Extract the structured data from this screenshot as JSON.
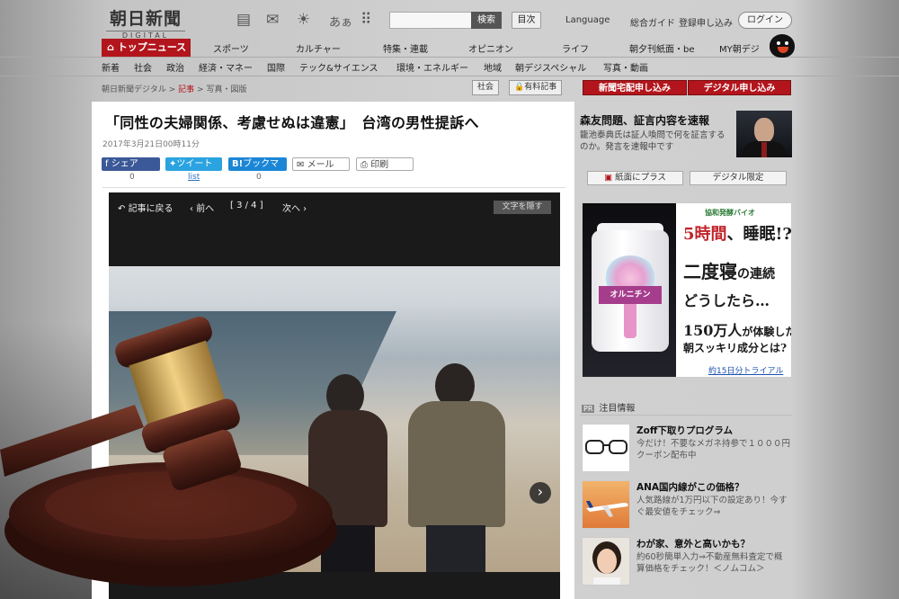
{
  "site": {
    "logo_main": "朝日新聞",
    "logo_sub": "DIGITAL",
    "search_button": "検索",
    "index_button": "目次",
    "language": "Language",
    "guide": "総合ガイド",
    "signup": "登録申し込み",
    "login": "ログイン",
    "ticon_font": "あぁ"
  },
  "nav_primary": {
    "active": "トップニュース",
    "items": [
      "スポーツ",
      "カルチャー",
      "特集・連載",
      "オピニオン",
      "ライフ",
      "朝夕刊紙面・be",
      "MY朝デジ"
    ]
  },
  "nav_secondary": {
    "items": [
      "新着",
      "社会",
      "政治",
      "経済・マネー",
      "国際",
      "テック&サイエンス",
      "環境・エネルギー",
      "地域",
      "朝デジスペシャル",
      "写真・動画"
    ]
  },
  "breadcrumb": {
    "root": "朝日新聞デジタル",
    "sep": ">",
    "section": "記事",
    "current": "写真・図版"
  },
  "tags": {
    "category": "社会",
    "paid": "有料記事"
  },
  "cta": {
    "paper": "新聞宅配申し込み",
    "digital": "デジタル申し込み"
  },
  "article": {
    "headline": "「同性の夫婦関係、考慮せぬは違憲」　台湾の男性提訴へ",
    "date": "2017年3月21日00時11分",
    "share": {
      "facebook": "シェア",
      "twitter": "ツイート",
      "hatena": "ブックマーク",
      "mail": "メール",
      "print": "印刷",
      "facebook_count": "0",
      "twitter_count": "list",
      "hatena_count": "0"
    }
  },
  "viewer": {
    "back": "記事に戻る",
    "prev": "前へ",
    "counter": "[ 3 / 4 ]",
    "next": "次へ",
    "hide_text": "文字を隠す"
  },
  "sidebar": {
    "top_story": {
      "title": "森友問題、証言内容を速報",
      "desc": "籠池泰典氏は証人喚問で何を証言するのか。発言を速報中です"
    },
    "buttons": {
      "paper_plus": "紙面にプラス",
      "digital_only": "デジタル限定"
    },
    "ad": {
      "brand": "協和発酵バイオ",
      "line1_red": "5時間",
      "line1_rest": "、睡眠!?",
      "line2_main": "二度寝",
      "line2_rest": "の連続",
      "line3": "どうしたら…",
      "line4_main": "150万人",
      "line4_rest": "が体験した",
      "line5": "朝スッキリ成分とは?",
      "bottle_label": "オルニチン",
      "link": "約15日分トライアル>>"
    },
    "pr_heading": "注目情報",
    "pr_badge": "PR",
    "pr_items": [
      {
        "title": "Zoff下取りプログラム",
        "desc": "今だけ！不要なメガネ持参で１０００円クーポン配布中"
      },
      {
        "title": "ANA国内線がこの価格？",
        "desc": "人気路線が1万円以下の設定あり！今すぐ最安値をチェック⇒"
      },
      {
        "title": "わが家、意外と高いかも？",
        "desc": "約60秒簡単入力⇒不動産無料査定で概算価格をチェック！＜ノムコム＞"
      }
    ]
  }
}
